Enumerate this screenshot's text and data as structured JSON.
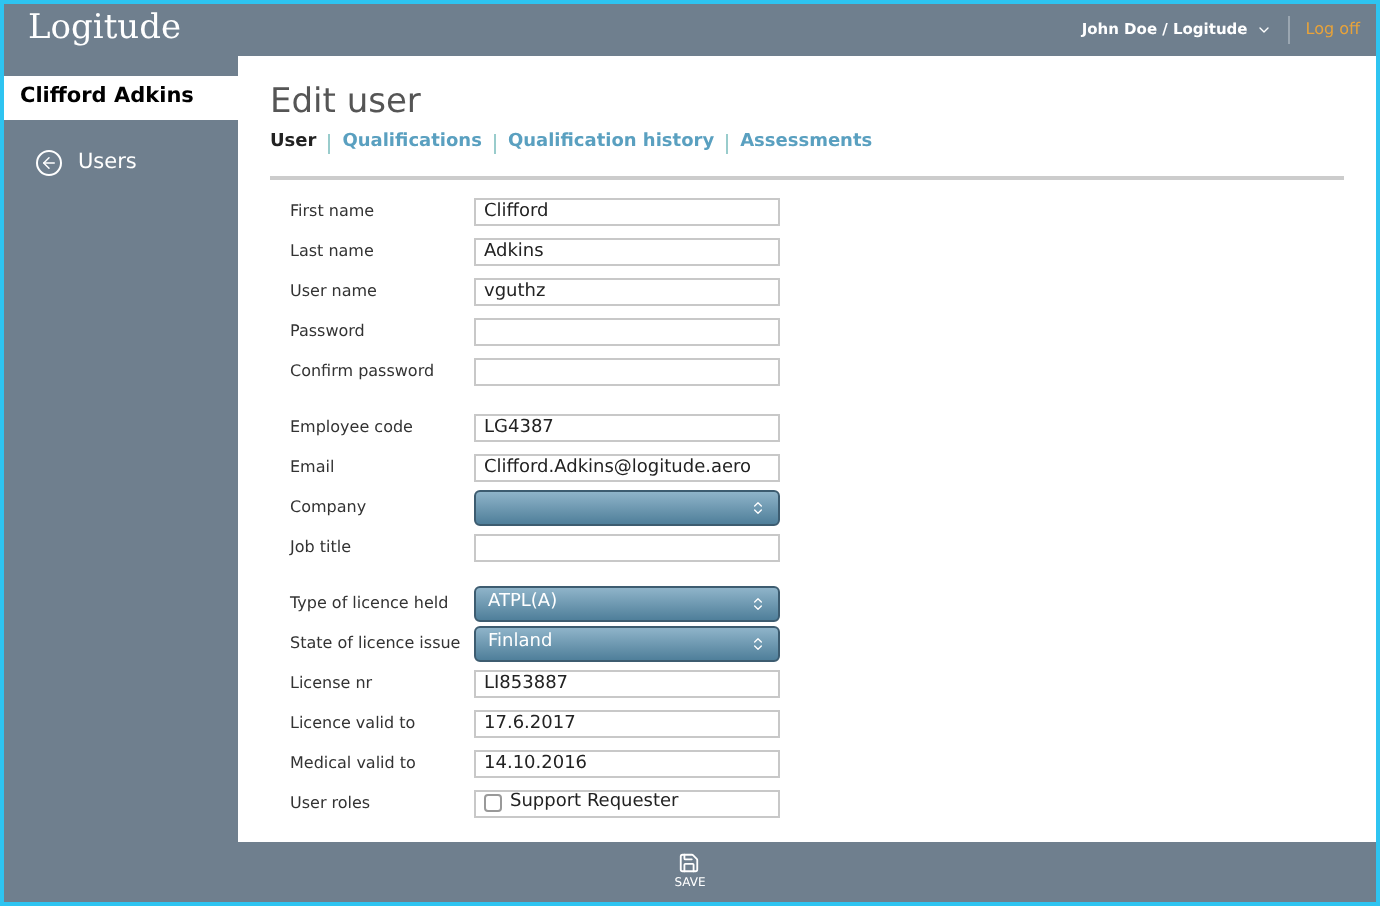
{
  "header": {
    "logo": "Logitude",
    "user_menu": "John Doe / Logitude",
    "logoff": "Log off"
  },
  "sidebar": {
    "title": "Clifford Adkins",
    "items": [
      {
        "label": "Users"
      }
    ]
  },
  "page": {
    "title": "Edit user",
    "tabs": [
      {
        "label": "User",
        "selected": true
      },
      {
        "label": "Qualifications",
        "selected": false
      },
      {
        "label": "Qualification history",
        "selected": false
      },
      {
        "label": "Assessments",
        "selected": false
      }
    ]
  },
  "form": {
    "groups": [
      {
        "fields": [
          {
            "kind": "text",
            "label": "First name",
            "value": "Clifford"
          },
          {
            "kind": "text",
            "label": "Last name",
            "value": "Adkins"
          },
          {
            "kind": "text",
            "label": "User name",
            "value": "vguthz"
          },
          {
            "kind": "text",
            "label": "Password"
          },
          {
            "kind": "text",
            "label": "Confirm password"
          }
        ]
      },
      {
        "fields": [
          {
            "kind": "text",
            "label": "Employee code",
            "value": "LG4387"
          },
          {
            "kind": "text",
            "label": "Email",
            "value": "Clifford.Adkins@logitude.aero"
          },
          {
            "kind": "select",
            "label": "Company"
          },
          {
            "kind": "text",
            "label": "Job title"
          }
        ]
      },
      {
        "fields": [
          {
            "kind": "select",
            "label": "Type of licence held",
            "value": "ATPL(A)"
          },
          {
            "kind": "select",
            "label": "State of licence issue",
            "value": "Finland"
          },
          {
            "kind": "text",
            "label": "License nr",
            "value": "LI853887"
          },
          {
            "kind": "text",
            "label": "Licence valid to",
            "value": "17.6.2017"
          },
          {
            "kind": "text",
            "label": "Medical valid to",
            "value": "14.10.2016"
          },
          {
            "kind": "checkbox",
            "label": "User roles",
            "value": "Support Requester",
            "checked": false
          }
        ]
      }
    ]
  },
  "footer": {
    "save": "SAVE"
  }
}
